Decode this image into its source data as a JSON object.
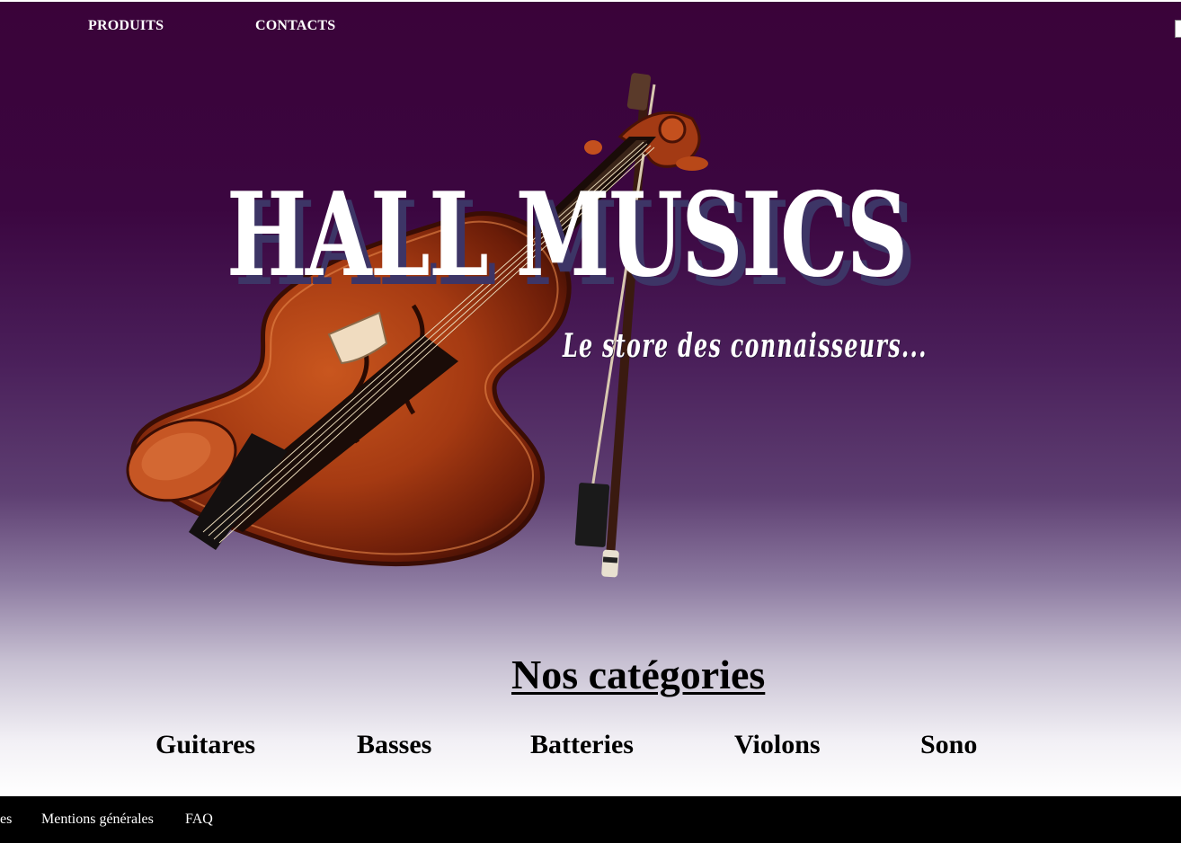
{
  "nav": {
    "items": [
      {
        "label": "PRODUITS"
      },
      {
        "label": "CONTACTS"
      }
    ]
  },
  "hero": {
    "brand": "HALL MUSICS",
    "tagline": "Le store des connaisseurs..."
  },
  "categories": {
    "title": "Nos catégories",
    "items": [
      {
        "label": "Guitares"
      },
      {
        "label": "Basses"
      },
      {
        "label": "Batteries"
      },
      {
        "label": "Violons"
      },
      {
        "label": "Sono"
      }
    ]
  },
  "footer": {
    "links": [
      {
        "label": "es"
      },
      {
        "label": "Mentions générales"
      },
      {
        "label": "FAQ"
      }
    ]
  },
  "colors": {
    "header_bg": "#3a0339",
    "footer_bg": "#000000",
    "brand_shadow": "#3d3566"
  },
  "icons": {
    "hero_image": "violin-illustration"
  }
}
